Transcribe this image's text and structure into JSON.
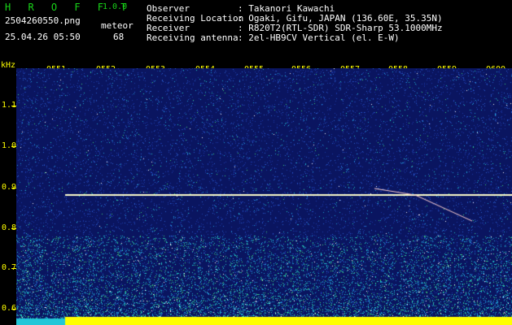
{
  "header": {
    "brand": "H R O F F T",
    "version": "1.0.0",
    "filename": "2504260550.png",
    "meteor_label": "meteor",
    "datetime": "25.04.26 05:50",
    "meteor_count": "68"
  },
  "info": [
    {
      "key": "Observer",
      "value": ": Takanori Kawachi"
    },
    {
      "key": "Receiving Location",
      "value": ": Ogaki, Gifu, JAPAN (136.60E, 35.35N)"
    },
    {
      "key": "Receiver",
      "value": ": R820T2(RTL-SDR) SDR-Sharp 53.1000MHz"
    },
    {
      "key": "Receiving antenna",
      "value": ": 2el-HB9CV Vertical (el. E-W)"
    }
  ],
  "time_labels": [
    "0551",
    "0552",
    "0553",
    "0554",
    "0555",
    "0556",
    "0557",
    "0558",
    "0559",
    "0600"
  ],
  "freq_unit": "kHz",
  "freq_labels": [
    "1.1",
    "1.0",
    "0.9",
    "0.8",
    "0.7",
    "0.6"
  ],
  "colors": {
    "background": "#0a1560",
    "label": "#ffff00",
    "brand": "#19d419",
    "carrier": "#ffffcc"
  }
}
